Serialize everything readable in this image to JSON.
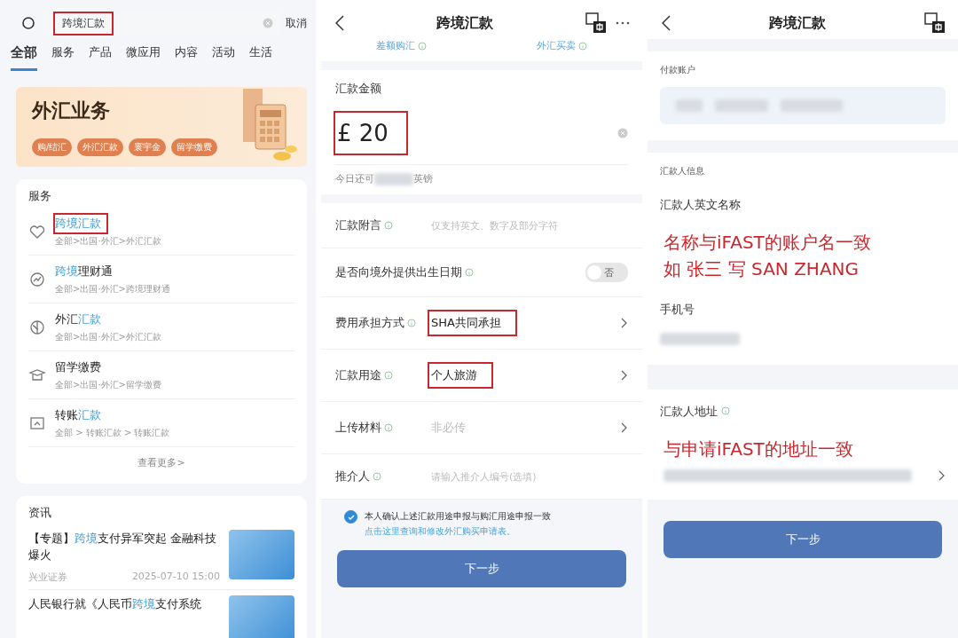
{
  "search_screen": {
    "search": {
      "value": "跨境汇款",
      "annotated": true
    },
    "cancel": "取消",
    "tabs": [
      {
        "label": "全部",
        "selected": true
      },
      {
        "label": "服务",
        "selected": false
      },
      {
        "label": "产品",
        "selected": false
      },
      {
        "label": "微应用",
        "selected": false
      },
      {
        "label": "内容",
        "selected": false
      },
      {
        "label": "活动",
        "selected": false
      },
      {
        "label": "生活",
        "selected": false
      }
    ],
    "banner": {
      "title": "外汇业务",
      "chips": [
        "购/结汇",
        "外汇汇款",
        "寰宇金",
        "留学缴费"
      ]
    },
    "services": {
      "heading": "服务",
      "more": "查看更多>",
      "items": [
        {
          "kind": "heart",
          "title": [
            {
              "text": "跨境汇款",
              "highlight": true
            }
          ],
          "path": "全部>出国·外汇>外汇汇款",
          "annotated": true
        },
        {
          "kind": "chart",
          "title": [
            {
              "text": "跨境",
              "highlight": true
            },
            {
              "text": "理财通",
              "highlight": false
            }
          ],
          "path": "全部>出国·外汇>跨境理财通",
          "annotated": false
        },
        {
          "kind": "globe",
          "title": [
            {
              "text": "外汇",
              "highlight": false
            },
            {
              "text": "汇款",
              "highlight": true
            }
          ],
          "path": "全部>出国·外汇>外汇汇款",
          "annotated": false
        },
        {
          "kind": "cap",
          "title": [
            {
              "text": "留学缴费",
              "highlight": false
            }
          ],
          "path": "全部>出国·外汇>留学缴费",
          "annotated": false
        },
        {
          "kind": "transfer",
          "title": [
            {
              "text": "转账",
              "highlight": false
            },
            {
              "text": "汇款",
              "highlight": true
            }
          ],
          "path": "全部 > 转账汇款 > 转账汇款",
          "annotated": false
        }
      ]
    },
    "news": {
      "heading": "资讯",
      "items": [
        {
          "title": [
            {
              "text": "【专题】",
              "highlight": false
            },
            {
              "text": "跨境",
              "highlight": true
            },
            {
              "text": "支付异军突起 金融科技爆火",
              "highlight": false
            }
          ],
          "source": "兴业证券",
          "time": "2025-07-10 15:00"
        },
        {
          "title": [
            {
              "text": "人民银行就《人民币",
              "highlight": false
            },
            {
              "text": "跨境",
              "highlight": true
            },
            {
              "text": "支付系统",
              "highlight": false
            }
          ]
        }
      ]
    }
  },
  "form_screen": {
    "title": "跨境汇款",
    "top_links": [
      "差额购汇",
      "外汇买卖"
    ],
    "amount": {
      "label": "汇款金额",
      "value": "£ 20",
      "annotated": true,
      "note_start": "今日还可",
      "note_end": "英镑"
    },
    "rows": [
      {
        "kind": "input",
        "label": "汇款附言",
        "placeholder": "仅支持英文、数字及部分字符"
      },
      {
        "kind": "toggle",
        "label": "是否向境外提供出生日期",
        "on": false,
        "off_label": "否"
      },
      {
        "kind": "select",
        "label": "费用承担方式",
        "value": "SHA共同承担",
        "annotated": true
      },
      {
        "kind": "select",
        "label": "汇款用途",
        "value": "个人旅游",
        "annotated": true
      },
      {
        "kind": "select",
        "label": "上传材料",
        "placeholder": "非必传",
        "annotated": false
      },
      {
        "kind": "input",
        "label": "推介人",
        "placeholder": "请输入推介人编号(选填)"
      }
    ],
    "confirm": {
      "checked": true,
      "text": "本人确认上述汇款用途申报与购汇用途申报一致",
      "link": "点击这里查询和修改外汇购买申请表。"
    },
    "button": "下一步"
  },
  "payer_screen": {
    "title": "跨境汇款",
    "account_label": "付款账户",
    "info_label": "汇款人信息",
    "name_label": "汇款人英文名称",
    "name_note": [
      "名称与iFAST的账户名一致",
      "如 张三  写 SAN ZHANG"
    ],
    "phone_label": "手机号",
    "address_label": "汇款人地址",
    "address_note": "与申请iFAST的地址一致",
    "button": "下一步"
  }
}
